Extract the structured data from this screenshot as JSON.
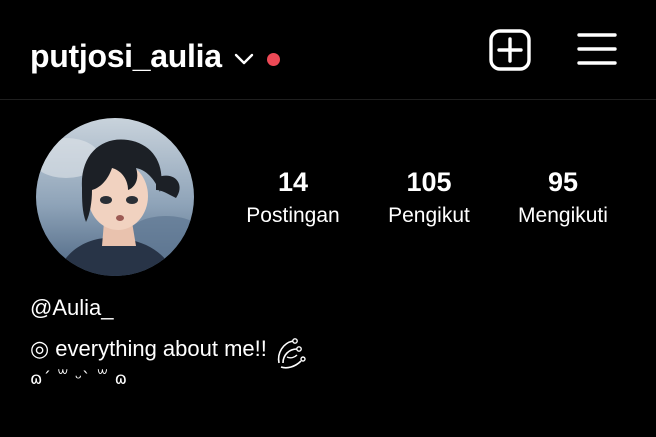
{
  "header": {
    "username": "putjosi_aulia",
    "switcher_icon": "chevron-down-icon",
    "notification_color": "#ed4956",
    "create_icon": "plus-square-icon",
    "menu_icon": "hamburger-menu-icon"
  },
  "profile": {
    "avatar_icon": "profile-avatar",
    "stats": [
      {
        "count": "14",
        "label": "Postingan"
      },
      {
        "count": "105",
        "label": "Pengikut"
      },
      {
        "count": "95",
        "label": "Mengikuti"
      }
    ],
    "display_name": "@Aulia_",
    "bio_line_1": "◎ everything about me!!",
    "bio_decoration_icon": "swirl-flourish-icon",
    "bio_line_2": "ɷ´ ꒳ ᵕ` ꒳ ɷ"
  },
  "colors": {
    "background": "#000000",
    "text": "#ffffff",
    "divider": "#1f1f1f",
    "notification_dot": "#ed4956"
  }
}
